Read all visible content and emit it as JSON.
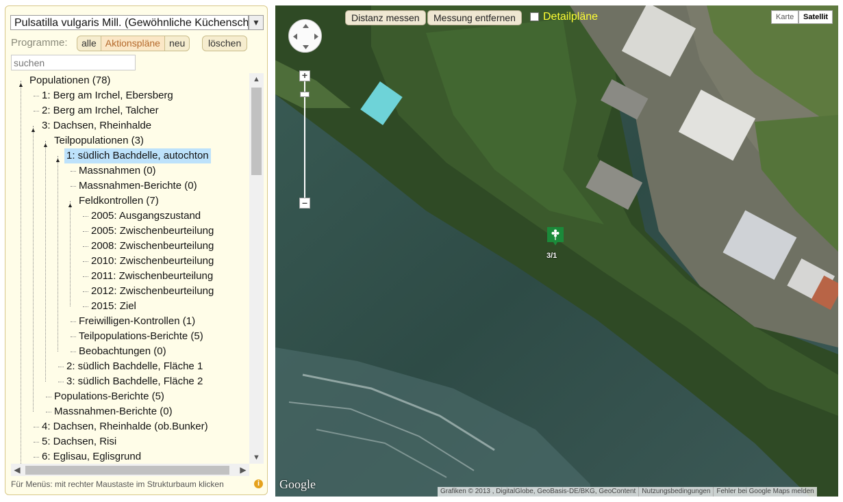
{
  "sidebar": {
    "species_select": "Pulsatilla vulgaris Mill. (Gewöhnliche Küchenschelle)",
    "programs_label": "Programme:",
    "program_buttons": [
      "alle",
      "Aktionspläne",
      "neu"
    ],
    "active_program": "Aktionspläne",
    "delete_button": "löschen",
    "search_placeholder": "suchen",
    "tree": [
      "Populationen (78)",
      "1: Berg am Irchel, Ebersberg",
      "2: Berg am Irchel, Talcher",
      "3: Dachsen, Rheinhalde",
      "Teilpopulationen (3)",
      "1: südlich Bachdelle, autochton",
      "Massnahmen (0)",
      "Massnahmen-Berichte (0)",
      "Feldkontrollen (7)",
      "2005: Ausgangszustand",
      "2005: Zwischenbeurteilung",
      "2008: Zwischenbeurteilung",
      "2010: Zwischenbeurteilung",
      "2011: Zwischenbeurteilung",
      "2012: Zwischenbeurteilung",
      "2015: Ziel",
      "Freiwilligen-Kontrollen (1)",
      "Teilpopulations-Berichte (5)",
      "Beobachtungen (0)",
      "2: südlich Bachdelle, Fläche 1",
      "3: südlich Bachdelle, Fläche 2",
      "Populations-Berichte (5)",
      "Massnahmen-Berichte (0)",
      "4: Dachsen, Rheinhalde (ob.Bunker)",
      "5: Dachsen, Risi",
      "6: Eglisau, Eglisgrund"
    ],
    "selected_item": "1: südlich Bachdelle, autochton",
    "footer_hint": "Für Menüs: mit rechter Maustaste im Strukturbaum klicken"
  },
  "map": {
    "measure_button": "Distanz messen",
    "remove_measure_button": "Messung entfernen",
    "detail_plans_label": "Detailpläne",
    "map_types": [
      "Karte",
      "Satellit"
    ],
    "active_map_type": "Satellit",
    "marker_label": "3/1",
    "google_logo": "Google",
    "attribution": [
      "Grafiken © 2013 , DigitalGlobe, GeoBasis-DE/BKG, GeoContent",
      "Nutzungsbedingungen",
      "Fehler bei Google Maps melden"
    ],
    "colors": {
      "detail_label": "#ffff33",
      "marker": "#1b8a3a",
      "selection": "#bde2fb"
    }
  }
}
